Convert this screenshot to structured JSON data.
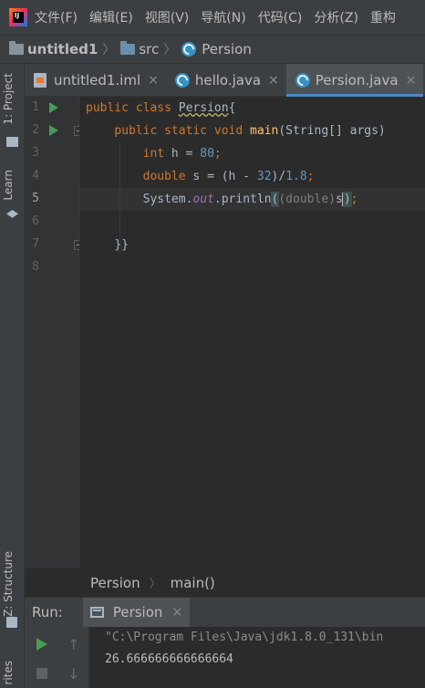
{
  "menubar": {
    "items": [
      "文件(F)",
      "编辑(E)",
      "视图(V)",
      "导航(N)",
      "代码(C)",
      "分析(Z)",
      "重构"
    ]
  },
  "navbar": {
    "project": "untitled1",
    "folder": "src",
    "class": "Persion"
  },
  "leftstrip": {
    "project_tab": "1: Project",
    "learn_tab": "Learn",
    "structure_tab": "Z: Structure",
    "favorites_tab": "rites"
  },
  "tabs": [
    {
      "label": "untitled1.iml",
      "active": false
    },
    {
      "label": "hello.java",
      "active": false
    },
    {
      "label": "Persion.java",
      "active": true
    }
  ],
  "editor": {
    "line_numbers": [
      "1",
      "2",
      "3",
      "4",
      "5",
      "6",
      "7",
      "8"
    ],
    "current_line": "5",
    "code": {
      "l1_kw1": "public",
      "l1_kw2": "class",
      "l1_name": "Persion",
      "l1_brace": "{",
      "l2_kw1": "public",
      "l2_kw2": "static",
      "l2_kw3": "void",
      "l2_fn": "main",
      "l2_rest": "(String[] args)",
      "l3_kw": "int",
      "l3_mid": " h = ",
      "l3_num": "80",
      "l3_end": ";",
      "l4_kw": "double",
      "l4_mid": " s = (h - ",
      "l4_num1": "32",
      "l4_mid2": ")/",
      "l4_num2": "1.8",
      "l4_end": ";",
      "l5_sys": "System.",
      "l5_out": "out",
      "l5_println": ".println",
      "l5_cast": "(double)",
      "l5_var": "s",
      "l5_end": ";",
      "l7": "}}"
    }
  },
  "code_crumbs": {
    "class": "Persion",
    "method": "main()"
  },
  "run": {
    "label": "Run:",
    "tab": "Persion",
    "command": "\"C:\\Program Files\\Java\\jdk1.8.0_131\\bin",
    "output": "26.666666666666664"
  }
}
